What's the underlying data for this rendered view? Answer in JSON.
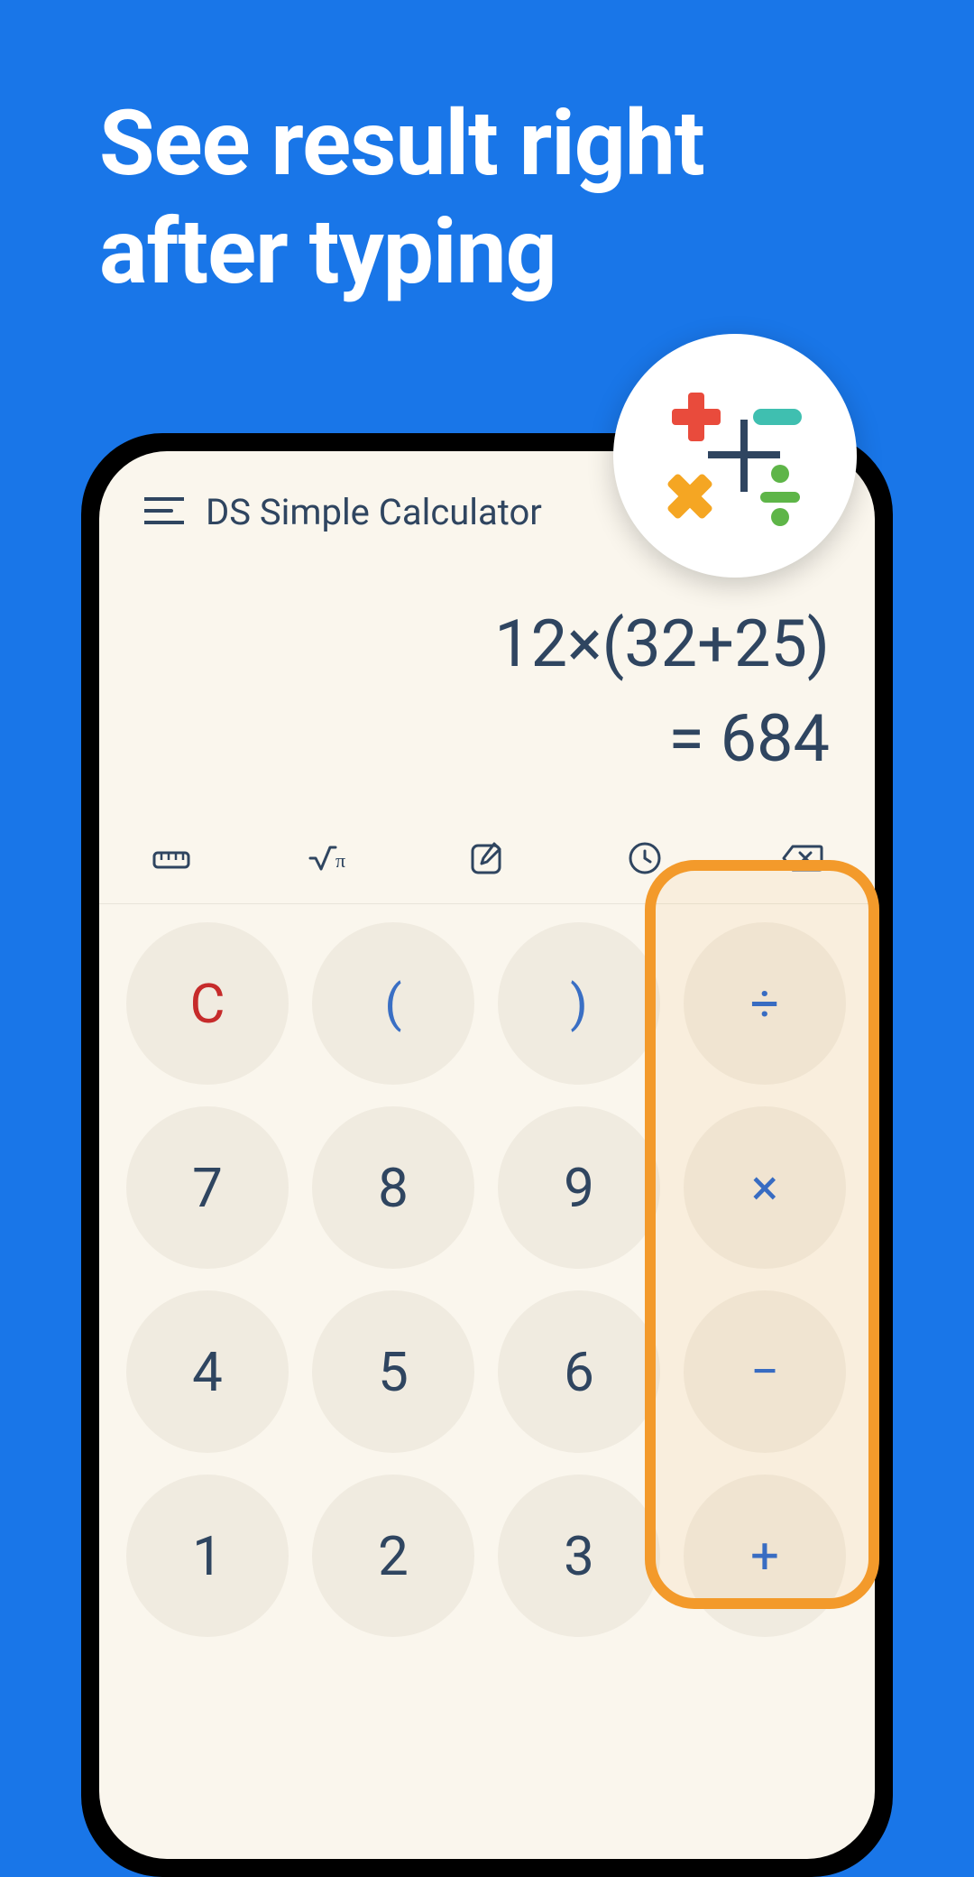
{
  "headline": "See result right after typing",
  "app": {
    "title": "DS Simple Calculator"
  },
  "display": {
    "expression": "12×(32+25)",
    "result": "= 684"
  },
  "toolbar": {
    "ruler": "ruler-icon",
    "sqrt": "sqrt-pi-icon",
    "edit": "edit-icon",
    "history": "history-icon",
    "backspace": "backspace-icon"
  },
  "keys": {
    "clear": "C",
    "lparen": "(",
    "rparen": ")",
    "divide": "÷",
    "k7": "7",
    "k8": "8",
    "k9": "9",
    "multiply": "×",
    "k4": "4",
    "k5": "5",
    "k6": "6",
    "minus": "−",
    "k1": "1",
    "k2": "2",
    "k3": "3",
    "plus": "+"
  }
}
